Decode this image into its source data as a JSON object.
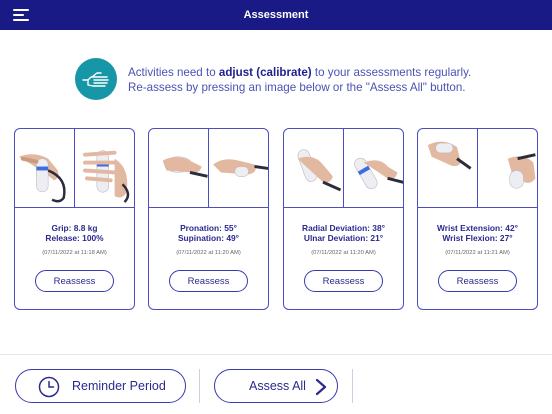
{
  "header": {
    "title": "Assessment",
    "menu_icon": "hamburger-menu-icon",
    "color": "#1a1a86"
  },
  "info": {
    "icon": "hand-icon",
    "line1_prefix": "Activities need to ",
    "line1_bold": "adjust (calibrate)",
    "line1_suffix": " to your assessments regularly.",
    "line2": "Re-assess by pressing an image below or the \"Assess All\" button.",
    "icon_color": "#1696a6"
  },
  "cards": [
    {
      "line1": "Grip: 8.8 kg",
      "line2": "Release: 100%",
      "date": "(07/11/2022 at 11:18 AM)",
      "button": "Reassess"
    },
    {
      "line1": "Pronation: 55°",
      "line2": "Supination: 49°",
      "date": "(07/11/2022 at 11:20 AM)",
      "button": "Reassess"
    },
    {
      "line1": "Radial Deviation: 38°",
      "line2": "Ulnar Deviation: 21°",
      "date": "(07/11/2022 at 11:20 AM)",
      "button": "Reassess"
    },
    {
      "line1": "Wrist Extension: 42°",
      "line2": "Wrist Flexion: 27°",
      "date": "(07/11/2022 at 11:21 AM)",
      "button": "Reassess"
    }
  ],
  "footer": {
    "reminder_label": "Reminder Period",
    "reminder_icon": "clock-icon",
    "assess_all_label": "Assess All",
    "assess_all_icon": "chevron-right-icon"
  }
}
